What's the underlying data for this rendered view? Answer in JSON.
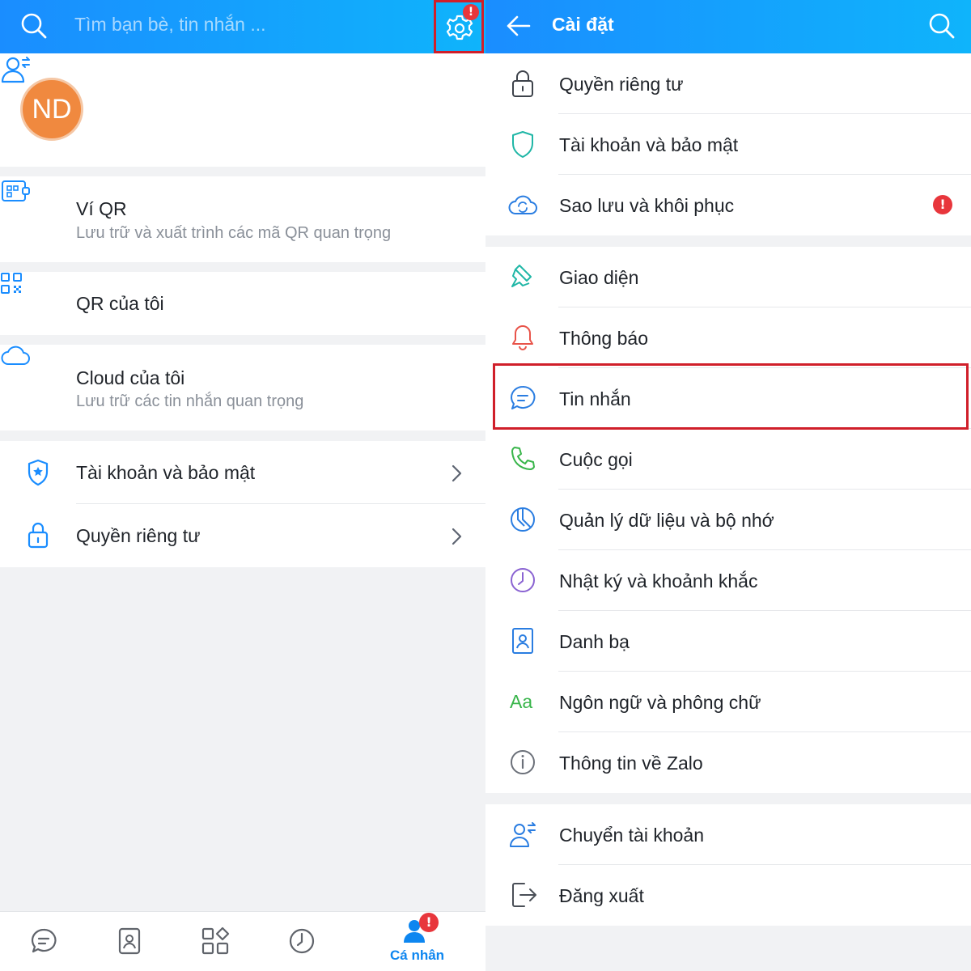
{
  "left": {
    "search": {
      "placeholder": "Tìm bạn bè, tin nhắn ..."
    },
    "settings_badge": "!",
    "profile": {
      "avatar_initials": "ND"
    },
    "items": [
      {
        "title": "Ví QR",
        "subtitle": "Lưu trữ và xuất trình các mã QR quan trọng",
        "icon": "qr-wallet-icon"
      },
      {
        "title": "QR của tôi",
        "icon": "qr-code-icon"
      },
      {
        "title": "Cloud của tôi",
        "subtitle": "Lưu trữ các tin nhắn quan trọng",
        "icon": "cloud-icon"
      },
      {
        "title": "Tài khoản và bảo mật",
        "icon": "shield-icon"
      },
      {
        "title": "Quyền riêng tư",
        "icon": "lock-icon"
      }
    ],
    "bottom_nav": {
      "tabs": [
        "messages-icon",
        "contacts-icon",
        "discover-icon",
        "timeline-icon",
        "personal-icon"
      ],
      "active_label": "Cá nhân",
      "active_badge": "!"
    }
  },
  "right": {
    "title": "Cài đặt",
    "alert_badge": "!",
    "items": [
      {
        "label": "Quyền riêng tư",
        "icon": "lock-icon"
      },
      {
        "label": "Tài khoản và bảo mật",
        "icon": "shield-icon"
      },
      {
        "label": "Sao lưu và khôi phục",
        "icon": "cloud-sync-icon"
      },
      {
        "label": "Giao diện",
        "icon": "paint-brush-icon"
      },
      {
        "label": "Thông báo",
        "icon": "bell-icon"
      },
      {
        "label": "Tin nhắn",
        "icon": "message-icon"
      },
      {
        "label": "Cuộc gọi",
        "icon": "phone-icon"
      },
      {
        "label": "Quản lý dữ liệu và bộ nhớ",
        "icon": "pie-chart-icon"
      },
      {
        "label": "Nhật ký và khoảnh khắc",
        "icon": "clock-icon"
      },
      {
        "label": "Danh bạ",
        "icon": "contact-icon"
      },
      {
        "label": "Ngôn ngữ và phông chữ",
        "icon": "font-icon",
        "icon_text": "Aa"
      },
      {
        "label": "Thông tin về Zalo",
        "icon": "info-icon"
      },
      {
        "label": "Chuyển tài khoản",
        "icon": "switch-account-icon"
      },
      {
        "label": "Đăng xuất",
        "icon": "logout-icon"
      }
    ]
  },
  "colors": {
    "header_gradient_start": "#1a8dff",
    "header_gradient_end": "#0fb4fb",
    "accent_blue": "#0d86f0",
    "highlight_red": "#d01f2a",
    "badge_red": "#e8363c",
    "avatar_orange": "#f0893f"
  }
}
